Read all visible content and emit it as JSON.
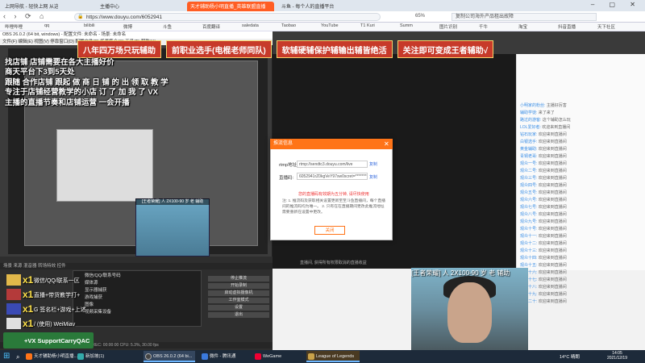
{
  "browser": {
    "tabs": [
      {
        "label": "上网导航 - 轻快上网 从这里开始"
      },
      {
        "label": "主播中心"
      },
      {
        "label": "天才辅助杨小明直播_英雄联盟直播",
        "active": true
      },
      {
        "label": "斗鱼 - 每个人的直播平台"
      }
    ],
    "url": "https://www.douyu.com/6052941",
    "zoom": "65%",
    "search_placeholder": "复制公司海外产品租出故障",
    "bookmarks": [
      "哔哩哔哩",
      "qq",
      "bilibili",
      "微博",
      "斗鱼",
      "百度翻译",
      "saledata",
      "Taobao",
      "YouTube",
      "T1 Kuri",
      "Summ",
      "图片识别",
      "千牛",
      "淘宝",
      "抖音直播",
      "天下社区"
    ]
  },
  "banner": {
    "items": [
      "八年四万场只玩辅助",
      "前职业选手(电棍老师同队)",
      "软辅硬辅保护辅输出辅皆绝活",
      "关注即可变成王者辅助√"
    ]
  },
  "obs": {
    "title": "OBS 26.0.2 (64 bit, windows) - 配置文件: 未命名 - 场景: 未命名",
    "menu": "文件(F)  编辑(E)  视图(V)  停靠窗口(D)  配置文件(P)  场景集合(S)  工具(T)  帮助(H)",
    "overlay_lines": [
      "找店铺 店铺需要在各大主播好价",
      "商天平台下3到5天处",
      "跟随 合作店铺 跟起 做 商 日 铺 的 出 领 取 教 学",
      "专注于店铺经营教学的小店 订 了 加 我 了 VX",
      "主播的直播节奏和店铺运营  一会开播"
    ],
    "docks_header": "场景  来源  混音器  转场特效  控件",
    "sources_title": "来源",
    "sources": [
      "微信/QQ/联系号码",
      "媒体源",
      "显示器捕获",
      "游戏捕获",
      "图像",
      "视频采集设备"
    ],
    "controls_title": "控件",
    "controls": [
      "停止推流",
      "开始录制",
      "启动虚拟摄像机",
      "工作室模式",
      "设置",
      "退出"
    ],
    "status": "LIVE: 00:00:00  REC: 00:00:00  CPU: 5.3%, 30.00 fps",
    "bottom_tabs": [
      "控件",
      "转场特效"
    ]
  },
  "captions": [
    {
      "mult": "x1",
      "name": "微信/QQ/联系一区"
    },
    {
      "mult": "x1",
      "name": "直播+带货教学打+"
    },
    {
      "mult": "x1",
      "name": "G 签名栏+游戏+上述"
    },
    {
      "mult": "x1",
      "name": "/ (使用) WeiMiav"
    }
  ],
  "vx_badge": "+VX SupportCarryQAC",
  "dialog": {
    "title": "推流信息",
    "rtmp_label": "rtmp地址:",
    "rtmp_value": "rtmp://sendtc3.douyu.com/live",
    "key_label": "直播码:",
    "key_value": "6052941rZ0kgVeY97sw0scret=**********",
    "copy": "复制",
    "warning": "您的直播码有效期为五分钟, 请尽快使用",
    "note": "注: 1. 推流码及获取相关设置更新至至斗鱼直播间，每个直播间的推流码均为唯一。 2. 只有在在直播期间更改此推流地址需要重新在设置中更改。",
    "close_btn": "关闭"
  },
  "under_text": "直播间, 获得所有权限取消的直播收益",
  "webcam_label": "[王者荣耀] 人 2X100-90 岁 老 辅助",
  "webcam_small_label": "[王者荣耀] 人 2X100-90 岁 老 辅助",
  "taskbar": {
    "items": [
      "天才辅助杨小明直播...",
      "新加坡(1)",
      "OBS 26.0.2 (64 bi...",
      "微件 - 腾讯通",
      "WeGame",
      "League of Legends"
    ],
    "weather": "14°C 晴朗",
    "time": "14:05",
    "date": "2021/12/19"
  },
  "chat": [
    {
      "name": "小明家的粉丝",
      "text": "主播好厉害"
    },
    {
      "name": "辅助学徒",
      "text": "来了来了"
    },
    {
      "name": "路过的游客",
      "text": "这个辅助怎么玩"
    },
    {
      "name": "LOL爱好者",
      "text": "欢迎来到直播间"
    },
    {
      "name": "钻石玩家",
      "text": "欢迎来到直播间"
    },
    {
      "name": "白银选手",
      "text": "欢迎来到直播间"
    },
    {
      "name": "黄金辅助",
      "text": "欢迎来到直播间"
    },
    {
      "name": "青铜老哥",
      "text": "欢迎来到直播间"
    },
    {
      "name": "观众一号",
      "text": "欢迎来到直播间"
    },
    {
      "name": "观众二号",
      "text": "欢迎来到直播间"
    },
    {
      "name": "观众三号",
      "text": "欢迎来到直播间"
    },
    {
      "name": "观众四号",
      "text": "欢迎来到直播间"
    },
    {
      "name": "观众五号",
      "text": "欢迎来到直播间"
    },
    {
      "name": "观众六号",
      "text": "欢迎来到直播间"
    },
    {
      "name": "观众七号",
      "text": "欢迎来到直播间"
    },
    {
      "name": "观众八号",
      "text": "欢迎来到直播间"
    },
    {
      "name": "观众九号",
      "text": "欢迎来到直播间"
    },
    {
      "name": "观众十号",
      "text": "欢迎来到直播间"
    },
    {
      "name": "观众十一",
      "text": "欢迎来到直播间"
    },
    {
      "name": "观众十二",
      "text": "欢迎来到直播间"
    },
    {
      "name": "观众十三",
      "text": "欢迎来到直播间"
    },
    {
      "name": "观众十四",
      "text": "欢迎来到直播间"
    },
    {
      "name": "观众十五",
      "text": "欢迎来到直播间"
    },
    {
      "name": "观众十六",
      "text": "欢迎来到直播间"
    },
    {
      "name": "观众十七",
      "text": "欢迎来到直播间"
    },
    {
      "name": "观众十八",
      "text": "欢迎来到直播间"
    },
    {
      "name": "观众十九",
      "text": "欢迎来到直播间"
    },
    {
      "name": "观众二十",
      "text": "欢迎来到直播间"
    }
  ],
  "colors": {
    "douyu_orange": "#ff7418",
    "banner_red": "#c73a2a",
    "caption_yellow": "#ffe24a"
  }
}
